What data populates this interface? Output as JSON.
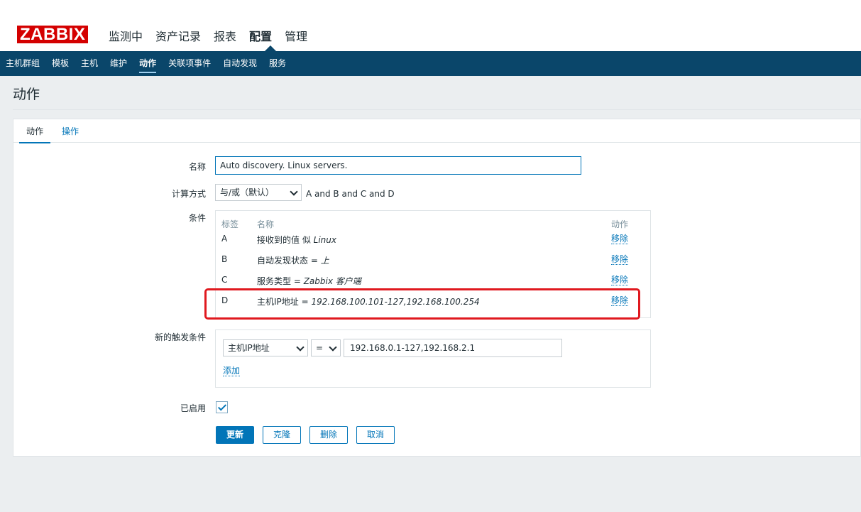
{
  "brand": {
    "logo": "ZABBIX",
    "logo_color": "#d40000"
  },
  "main_menu": [
    {
      "label": "监测中"
    },
    {
      "label": "资产记录"
    },
    {
      "label": "报表"
    },
    {
      "label": "配置",
      "active": true
    },
    {
      "label": "管理"
    }
  ],
  "sub_menu": [
    {
      "label": "主机群组"
    },
    {
      "label": "模板"
    },
    {
      "label": "主机"
    },
    {
      "label": "维护"
    },
    {
      "label": "动作",
      "active": true
    },
    {
      "label": "关联项事件"
    },
    {
      "label": "自动发现"
    },
    {
      "label": "服务"
    }
  ],
  "page": {
    "title": "动作"
  },
  "tabs": [
    {
      "label": "动作",
      "active": true
    },
    {
      "label": "操作"
    }
  ],
  "form": {
    "name_label": "名称",
    "name_value": "Auto discovery. Linux servers.",
    "calc_label": "计算方式",
    "calc_value": "与/或（默认）",
    "calc_formula": "A and B and C and D",
    "conditions_label": "条件",
    "conditions": {
      "headers": {
        "label": "标签",
        "name": "名称",
        "action": "动作"
      },
      "rows": [
        {
          "label": "A",
          "name": "接收到的值 似 ",
          "value": "Linux",
          "remove": "移除"
        },
        {
          "label": "B",
          "name": "自动发现状态 = ",
          "value": "上",
          "remove": "移除"
        },
        {
          "label": "C",
          "name": "服务类型 = ",
          "value": "Zabbix 客户端",
          "remove": "移除"
        },
        {
          "label": "D",
          "name": "主机IP地址 = ",
          "value": "192.168.100.101-127,192.168.100.254",
          "remove": "移除"
        }
      ]
    },
    "new_condition_label": "新的触发条件",
    "new_condition": {
      "type": "主机IP地址",
      "operator": "=",
      "value": "192.168.0.1-127,192.168.2.1",
      "add": "添加"
    },
    "enabled_label": "已启用",
    "enabled": true
  },
  "buttons": {
    "update": "更新",
    "clone": "克隆",
    "delete": "删除",
    "cancel": "取消"
  },
  "colors": {
    "accent": "#0275b8",
    "nav": "#0a466a",
    "highlight": "#e0191f"
  }
}
